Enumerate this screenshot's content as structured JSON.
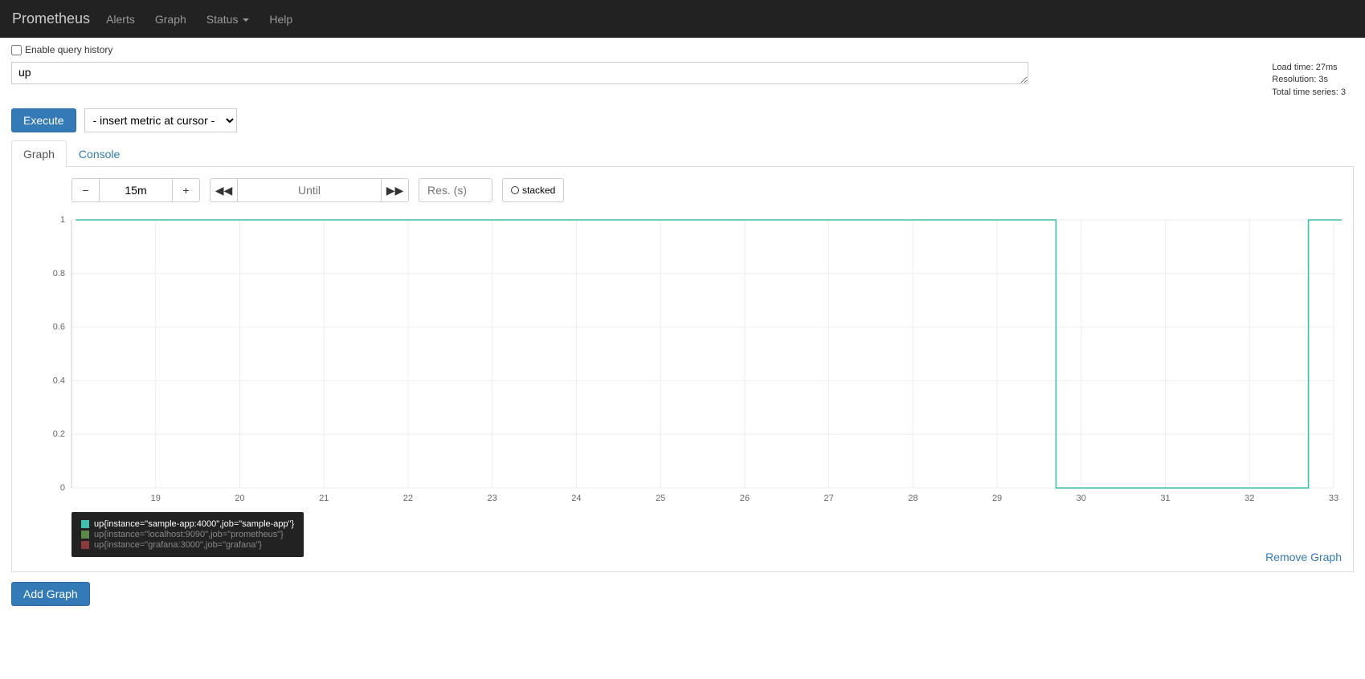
{
  "navbar": {
    "brand": "Prometheus",
    "items": [
      "Alerts",
      "Graph",
      "Status",
      "Help"
    ],
    "dropdown_index": 2
  },
  "history_checkbox": {
    "label": "Enable query history",
    "checked": false
  },
  "query": {
    "value": "up"
  },
  "meta": {
    "load_time": "Load time: 27ms",
    "resolution": "Resolution: 3s",
    "total_series": "Total time series: 3"
  },
  "execute_label": "Execute",
  "metric_select_placeholder": "- insert metric at cursor -",
  "tabs": {
    "graph": "Graph",
    "console": "Console",
    "active": "graph"
  },
  "controls": {
    "range": "15m",
    "until_placeholder": "Until",
    "res_placeholder": "Res. (s)",
    "stacked_label": "stacked"
  },
  "chart_data": {
    "type": "line",
    "xlabel": "",
    "ylabel": "",
    "ylim": [
      0,
      1
    ],
    "yticks": [
      0,
      0.2,
      0.4,
      0.6,
      0.8,
      1
    ],
    "x": [
      18,
      19,
      20,
      21,
      22,
      23,
      24,
      25,
      26,
      27,
      28,
      29,
      30,
      31,
      32,
      33
    ],
    "xticks": [
      19,
      20,
      21,
      22,
      23,
      24,
      25,
      26,
      27,
      28,
      29,
      30,
      31,
      32,
      33
    ],
    "series": [
      {
        "name": "up{instance=\"sample-app:4000\",job=\"sample-app\"}",
        "color": "#3fbfad",
        "values": [
          1,
          1,
          1,
          1,
          1,
          1,
          1,
          1,
          1,
          1,
          1,
          1,
          0,
          0,
          0,
          1
        ],
        "step_x": [
          18.05,
          29.7,
          29.7,
          32.7,
          32.7,
          33.2
        ],
        "step_y": [
          1,
          1,
          0,
          0,
          1,
          1
        ]
      },
      {
        "name": "up{instance=\"localhost:9090\",job=\"prometheus\"}",
        "color": "#5b8a47",
        "values": []
      },
      {
        "name": "up{instance=\"grafana:3000\",job=\"grafana\"}",
        "color": "#8a3a3a",
        "values": []
      }
    ]
  },
  "remove_graph_label": "Remove Graph",
  "add_graph_label": "Add Graph"
}
